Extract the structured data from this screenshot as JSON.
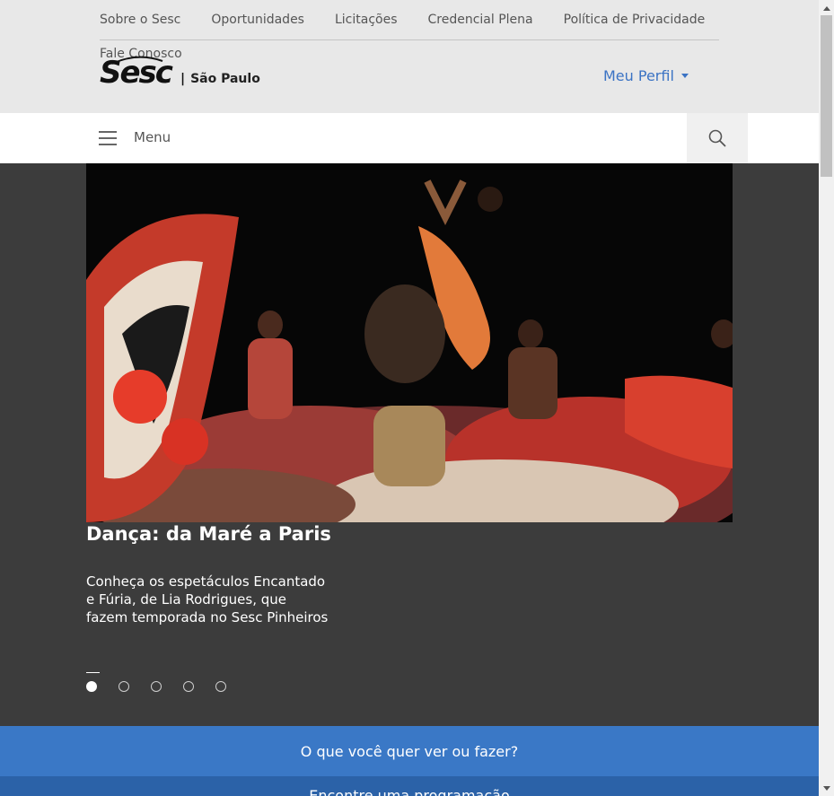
{
  "top_nav": {
    "links": [
      "Sobre o Sesc",
      "Oportunidades",
      "Licitações",
      "Credencial Plena",
      "Política de Privacidade"
    ],
    "fale_conosco": "Fale Conosco"
  },
  "logo": {
    "wordmark": "Sesc",
    "separator": "|",
    "city": "São Paulo"
  },
  "profile": {
    "label": "Meu Perfil"
  },
  "navbar": {
    "menu_label": "Menu",
    "menu_icon": "hamburger-icon",
    "search_icon": "search-icon"
  },
  "hero": {
    "title": "Dança: da Maré a Paris",
    "description": "Conheça os espetáculos Encantado e Fúria, de Lia Rodrigues, que fazem temporada no Sesc Pinheiros",
    "slides_count": 5,
    "active_slide": 1
  },
  "cta": {
    "primary": "O que você quer ver ou fazer?",
    "secondary": "Encontre uma programação"
  },
  "colors": {
    "accent": "#3b73c4",
    "cta_bg": "#3a78c6",
    "hero_bg": "#3c3c3c",
    "topbar_bg": "#e8e8e8"
  }
}
